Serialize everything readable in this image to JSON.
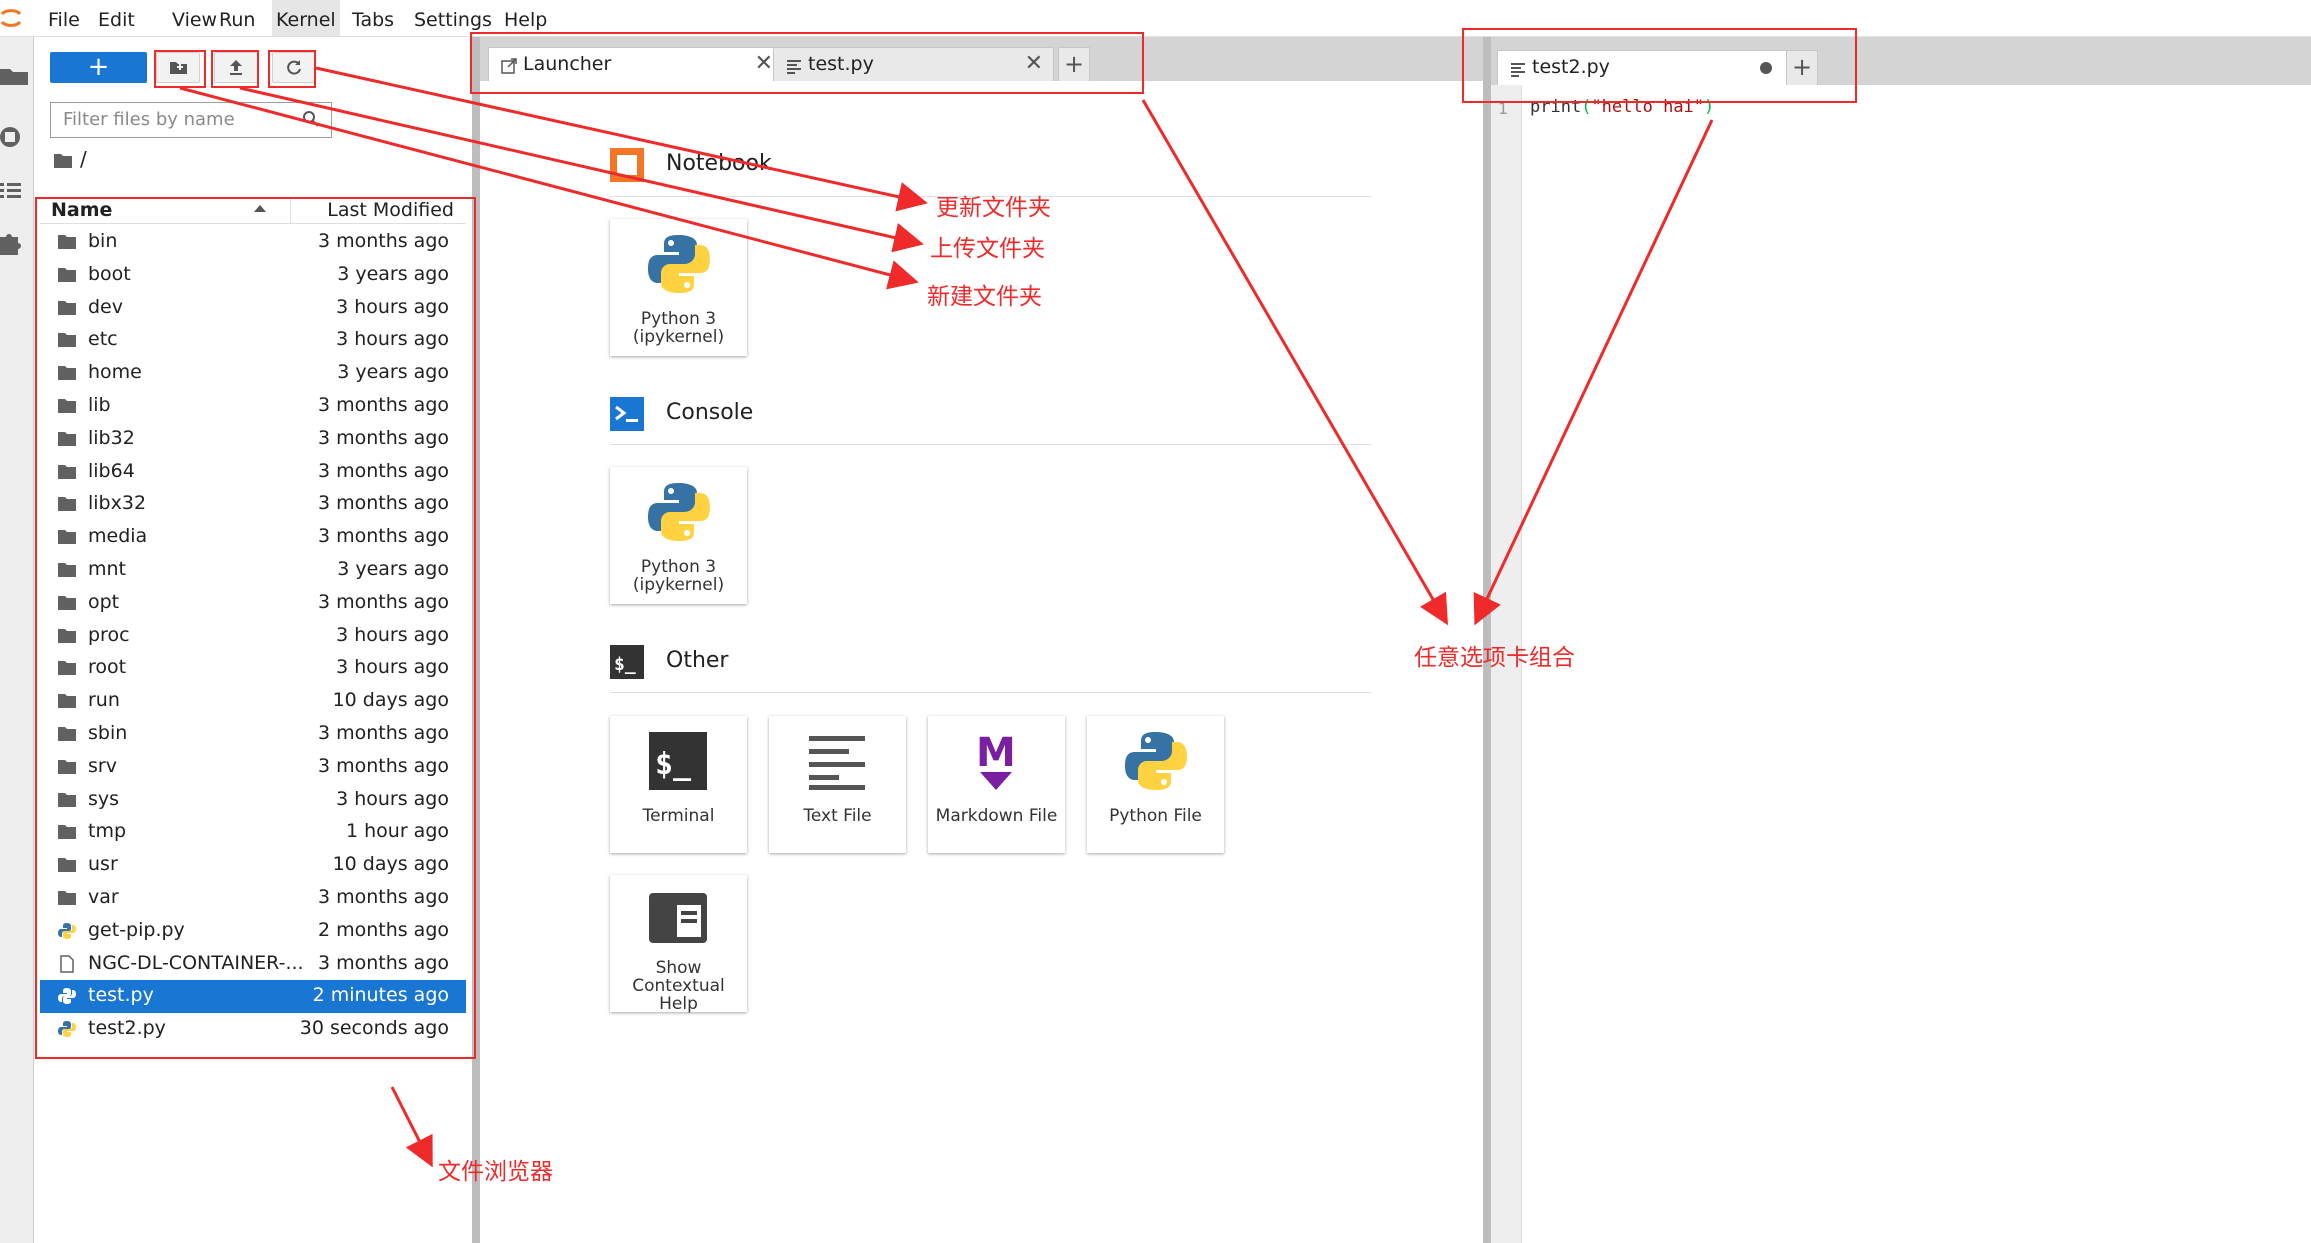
{
  "menu": [
    "File",
    "Edit",
    "View",
    "Run",
    "Kernel",
    "Tabs",
    "Settings",
    "Help"
  ],
  "menu_active": "Kernel",
  "filebrowser": {
    "new_button_label": "+",
    "filter_placeholder": "Filter files by name",
    "path": "/",
    "columns": {
      "name": "Name",
      "modified": "Last Modified"
    },
    "files": [
      {
        "name": "bin",
        "type": "folder",
        "modified": "3 months ago"
      },
      {
        "name": "boot",
        "type": "folder",
        "modified": "3 years ago"
      },
      {
        "name": "dev",
        "type": "folder",
        "modified": "3 hours ago"
      },
      {
        "name": "etc",
        "type": "folder",
        "modified": "3 hours ago"
      },
      {
        "name": "home",
        "type": "folder",
        "modified": "3 years ago"
      },
      {
        "name": "lib",
        "type": "folder",
        "modified": "3 months ago"
      },
      {
        "name": "lib32",
        "type": "folder",
        "modified": "3 months ago"
      },
      {
        "name": "lib64",
        "type": "folder",
        "modified": "3 months ago"
      },
      {
        "name": "libx32",
        "type": "folder",
        "modified": "3 months ago"
      },
      {
        "name": "media",
        "type": "folder",
        "modified": "3 months ago"
      },
      {
        "name": "mnt",
        "type": "folder",
        "modified": "3 years ago"
      },
      {
        "name": "opt",
        "type": "folder",
        "modified": "3 months ago"
      },
      {
        "name": "proc",
        "type": "folder",
        "modified": "3 hours ago"
      },
      {
        "name": "root",
        "type": "folder",
        "modified": "3 hours ago"
      },
      {
        "name": "run",
        "type": "folder",
        "modified": "10 days ago"
      },
      {
        "name": "sbin",
        "type": "folder",
        "modified": "3 months ago"
      },
      {
        "name": "srv",
        "type": "folder",
        "modified": "3 months ago"
      },
      {
        "name": "sys",
        "type": "folder",
        "modified": "3 hours ago"
      },
      {
        "name": "tmp",
        "type": "folder",
        "modified": "1 hour ago"
      },
      {
        "name": "usr",
        "type": "folder",
        "modified": "10 days ago"
      },
      {
        "name": "var",
        "type": "folder",
        "modified": "3 months ago"
      },
      {
        "name": "get-pip.py",
        "type": "python",
        "modified": "2 months ago"
      },
      {
        "name": "NGC-DL-CONTAINER-...",
        "type": "file",
        "modified": "3 months ago"
      },
      {
        "name": "test.py",
        "type": "python",
        "modified": "2 minutes ago",
        "selected": true
      },
      {
        "name": "test2.py",
        "type": "python",
        "modified": "30 seconds ago"
      }
    ]
  },
  "left_tabs": [
    {
      "label": "Launcher",
      "icon": "launcher-icon",
      "current": true
    },
    {
      "label": "test.py",
      "icon": "text-file-icon",
      "current": false
    }
  ],
  "right_tabs": [
    {
      "label": "test2.py",
      "icon": "text-file-icon",
      "current": true,
      "modified": true
    }
  ],
  "add_tab_label": "+",
  "launcher": {
    "sections": [
      {
        "title": "Notebook",
        "icon": "notebook-icon",
        "cards": [
          {
            "label": "Python 3\n(ipykernel)",
            "icon": "python-logo-icon"
          }
        ]
      },
      {
        "title": "Console",
        "icon": "console-icon",
        "cards": [
          {
            "label": "Python 3\n(ipykernel)",
            "icon": "python-logo-icon"
          }
        ]
      },
      {
        "title": "Other",
        "icon": "terminal-icon",
        "cards": [
          {
            "label": "Terminal",
            "icon": "terminal-icon"
          },
          {
            "label": "Text File",
            "icon": "text-file-icon"
          },
          {
            "label": "Markdown File",
            "icon": "markdown-icon"
          },
          {
            "label": "Python File",
            "icon": "python-logo-icon"
          },
          {
            "label": "Show\nContextual\nHelp",
            "icon": "contextual-help-icon"
          }
        ]
      }
    ]
  },
  "editor": {
    "line_number": "1",
    "code_fn": "print",
    "code_open": "(",
    "code_str": "\"hello hai\"",
    "code_close": ")"
  },
  "annotations": {
    "refresh_folder": "更新文件夹",
    "upload_folder": "上传文件夹",
    "new_folder": "新建文件夹",
    "tab_combination": "任意选项卡组合",
    "file_browser": "文件浏览器"
  },
  "colors": {
    "accent": "#1976d2",
    "annotation": "#ee2a2a",
    "notebook_orange": "#f37626",
    "markdown_purple": "#7b1fa2"
  }
}
